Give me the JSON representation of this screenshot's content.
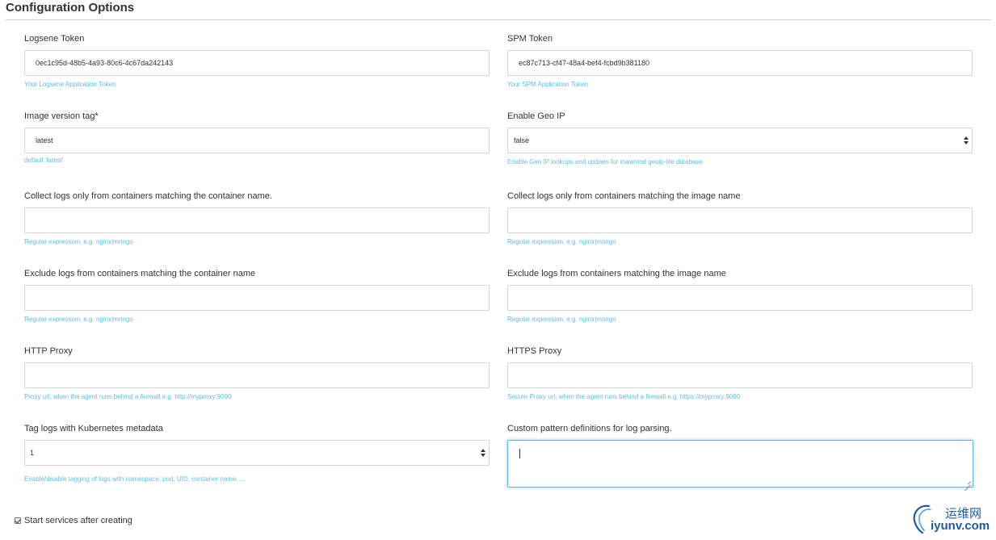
{
  "section": {
    "title": "Configuration Options"
  },
  "fields": {
    "logsene_token": {
      "label": "Logsene Token",
      "value": "0ec1c95d-48b5-4a93-80c6-4c67da242143",
      "help": "Your Logsene Application Token"
    },
    "spm_token": {
      "label": "SPM Token",
      "value": "ec87c713-cf47-48a4-bef4-fcbd9b381180",
      "help": "Your SPM Application Token"
    },
    "image_version": {
      "label": "Image version tag*",
      "value": "latest",
      "help": "default 'latest'"
    },
    "geo_ip": {
      "label": "Enable Geo IP",
      "value": "false",
      "help": "Enable Geo IP lookups and updaes for maxmind geoip-lite database"
    },
    "container_name": {
      "label": "Collect logs only from containers matching the container name.",
      "value": "",
      "help": "Regular expression, e.g. nginx|mongo"
    },
    "image_name": {
      "label": "Collect logs only from containers matching the image name",
      "value": "",
      "help": "Regular expression, e.g. nginx|mongo"
    },
    "exclude_container": {
      "label": "Exclude logs from containers matching the container name",
      "value": "",
      "help": "Regular expression, e.g. nginx|mongo"
    },
    "exclude_image": {
      "label": "Exclude logs from containers matching the image name",
      "value": "",
      "help": "Regular expression, e.g. nginx|mongo"
    },
    "http_proxy": {
      "label": "HTTP Proxy",
      "value": "",
      "help": "Proxy url, when the agent runs behind a firewall e.g. http://myproxy:9090"
    },
    "https_proxy": {
      "label": "HTTPS Proxy",
      "value": "",
      "help": "Secure Proxy url, when the agent runs behind a firewall e.g. https://myproxy:9090"
    },
    "k8s_metadata": {
      "label": "Tag logs with Kubernetes metadata",
      "value": "1",
      "help": "Enable/disable tagging of logs with namespace, pod, UID, container name, ..."
    },
    "custom_patterns": {
      "label": "Custom pattern definitions for log parsing.",
      "value": ""
    }
  },
  "start_services": {
    "label": "Start services after creating",
    "checked": true
  },
  "watermark": {
    "chinese": "运维网",
    "domain": "iyunv.com"
  },
  "colors": {
    "help": "#5bc0de",
    "focus_border": "#66afe9",
    "watermark": "#1e5aa8"
  },
  "icons": {
    "select_caret": "chevron-updown-icon",
    "checkbox": "check-icon",
    "watermark_logo": "swirl-logo-icon"
  }
}
